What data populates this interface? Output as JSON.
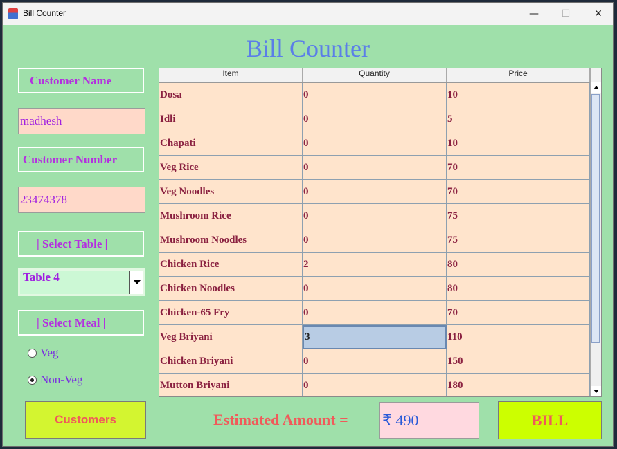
{
  "window": {
    "title": "Bill Counter",
    "min_label": "—",
    "max_label": "☐",
    "close_label": "✕"
  },
  "app_title": "Bill Counter",
  "left": {
    "customer_name_label": "Customer Name",
    "customer_name_value": "madhesh",
    "customer_number_label": "Customer Number",
    "customer_number_value": "23474378",
    "select_table_label": "| Select Table |",
    "table_selected": "Table 4",
    "select_meal_label": "| Select Meal |",
    "meal_options": [
      "Veg",
      "Non-Veg"
    ],
    "meal_selected": "Non-Veg"
  },
  "table": {
    "columns": [
      "Item",
      "Quantity",
      "Price"
    ],
    "rows": [
      [
        "Dosa",
        "0",
        "10"
      ],
      [
        "Idli",
        "0",
        "5"
      ],
      [
        "Chapati",
        "0",
        "10"
      ],
      [
        "Veg Rice",
        "0",
        "70"
      ],
      [
        "Veg Noodles",
        "0",
        "70"
      ],
      [
        "Mushroom Rice",
        "0",
        "75"
      ],
      [
        "Mushroom Noodles",
        "0",
        "75"
      ],
      [
        "Chicken Rice",
        "2",
        "80"
      ],
      [
        "Chicken Noodles",
        "0",
        "80"
      ],
      [
        "Chicken-65 Fry",
        "0",
        "70"
      ],
      [
        "Veg Briyani",
        "3",
        "110"
      ],
      [
        "Chicken Briyani",
        "0",
        "150"
      ],
      [
        "Mutton Briyani",
        "0",
        "180"
      ]
    ],
    "selected_cell": {
      "row": 10,
      "col": 1
    }
  },
  "bottom": {
    "customers_button": "Customers",
    "estimated_label": "Estimated Amount =",
    "amount_value": "₹ 490",
    "bill_button": "BILL"
  }
}
